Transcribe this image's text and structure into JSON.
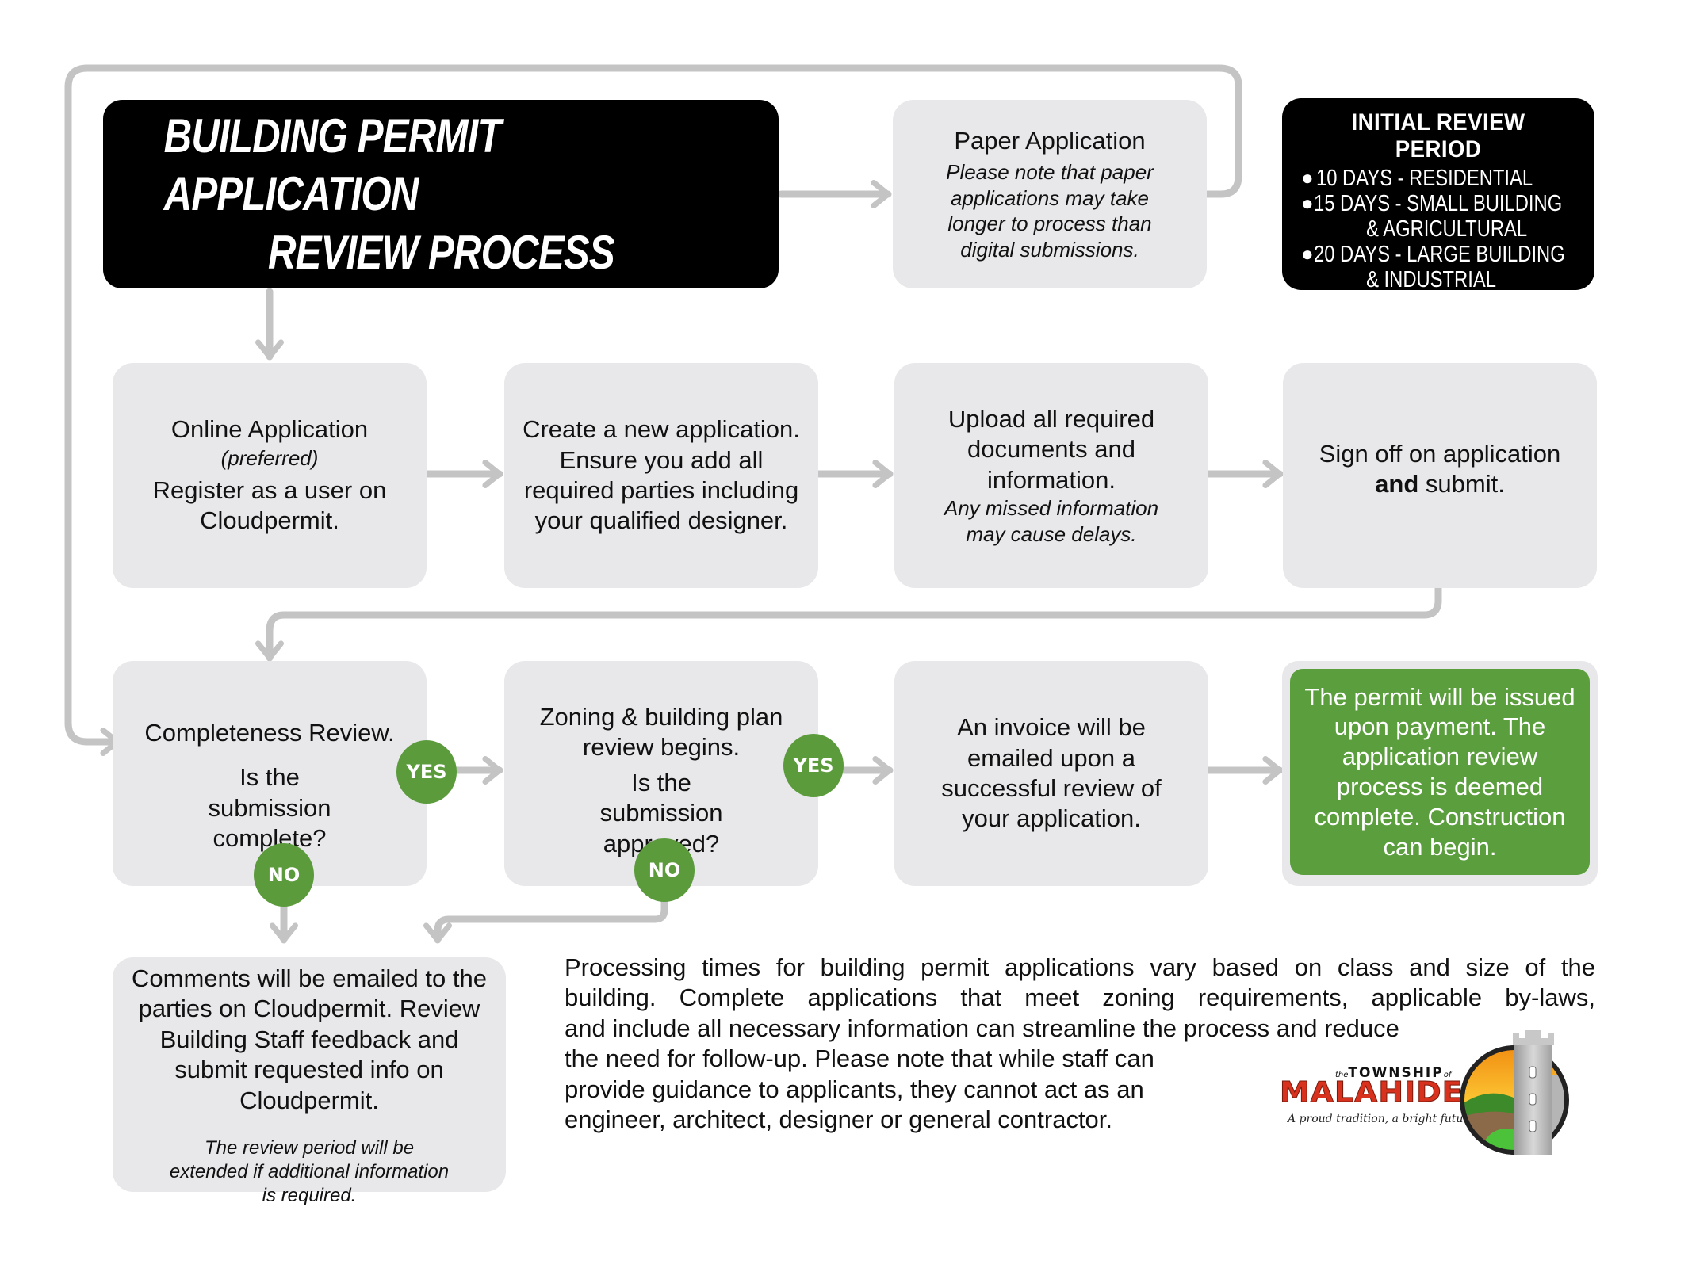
{
  "title": {
    "line1": "BUILDING PERMIT APPLICATION",
    "line2": "REVIEW PROCESS"
  },
  "paper_application": {
    "heading": "Paper Application",
    "note": "Please note that paper applications may take longer to process than digital submissions."
  },
  "initial_review_period": {
    "heading": "INITIAL REVIEW PERIOD",
    "items": [
      {
        "days": "10 DAYS",
        "category": "RESIDENTIAL",
        "text": "10 DAYS - RESIDENTIAL"
      },
      {
        "days": "15 DAYS",
        "category": "SMALL BUILDING & AGRICULTURAL",
        "text": "15 DAYS - SMALL BUILDING\n          & AGRICULTURAL"
      },
      {
        "days": "20 DAYS",
        "category": "LARGE BUILDING & INDUSTRIAL",
        "text": "20 DAYS - LARGE BUILDING\n          & INDUSTRIAL"
      }
    ]
  },
  "steps": {
    "online_application": {
      "heading": "Online Application",
      "subheading": "(preferred)",
      "body": "Register as a user on Cloudpermit."
    },
    "create_application": {
      "body": "Create a new application. Ensure you add all required parties including your qualified designer."
    },
    "upload_documents": {
      "body": "Upload all required documents and information.",
      "note": "Any missed information may cause delays."
    },
    "sign_off": {
      "body_pre": "Sign off on application",
      "body_bold": "and",
      "body_post": "submit."
    },
    "completeness_review": {
      "heading": "Completeness Review.",
      "question": "Is the submission complete?"
    },
    "zoning_review": {
      "heading": "Zoning & building plan review begins.",
      "question": "Is the submission approved?"
    },
    "invoice": {
      "body": "An invoice will be emailed upon a successful review of your application."
    },
    "permit_issued": {
      "body": "The permit will be issued upon payment. The application review process is deemed complete. Construction can begin."
    },
    "comments": {
      "body": "Comments will be emailed to the parties on Cloudpermit. Review Building Staff feedback and submit requested info on Cloudpermit.",
      "note": "The review period will be extended if additional information is required."
    }
  },
  "decisions": {
    "yes_label": "YES",
    "no_label": "NO"
  },
  "footer_note": {
    "lines": [
      "Processing times for building permit applications vary based on class and size of the",
      "building. Complete applications that meet zoning requirements, applicable by-laws,",
      "and include all necessary information can streamline the process and reduce",
      "the need for follow-up. Please note that while staff can",
      "provide guidance to applicants, they cannot act as an",
      "engineer, architect, designer or general contractor."
    ]
  },
  "logo": {
    "prefix": "the",
    "township": "TOWNSHIP",
    "of": "of",
    "name": "MALAHIDE",
    "tagline": "A proud tradition, a bright future."
  },
  "colors": {
    "box_grey": "#e8e8ea",
    "connector_grey": "#c4c4c4",
    "decision_green": "#5b9b3c",
    "final_green": "#5b9e3d",
    "title_black": "#000000"
  }
}
